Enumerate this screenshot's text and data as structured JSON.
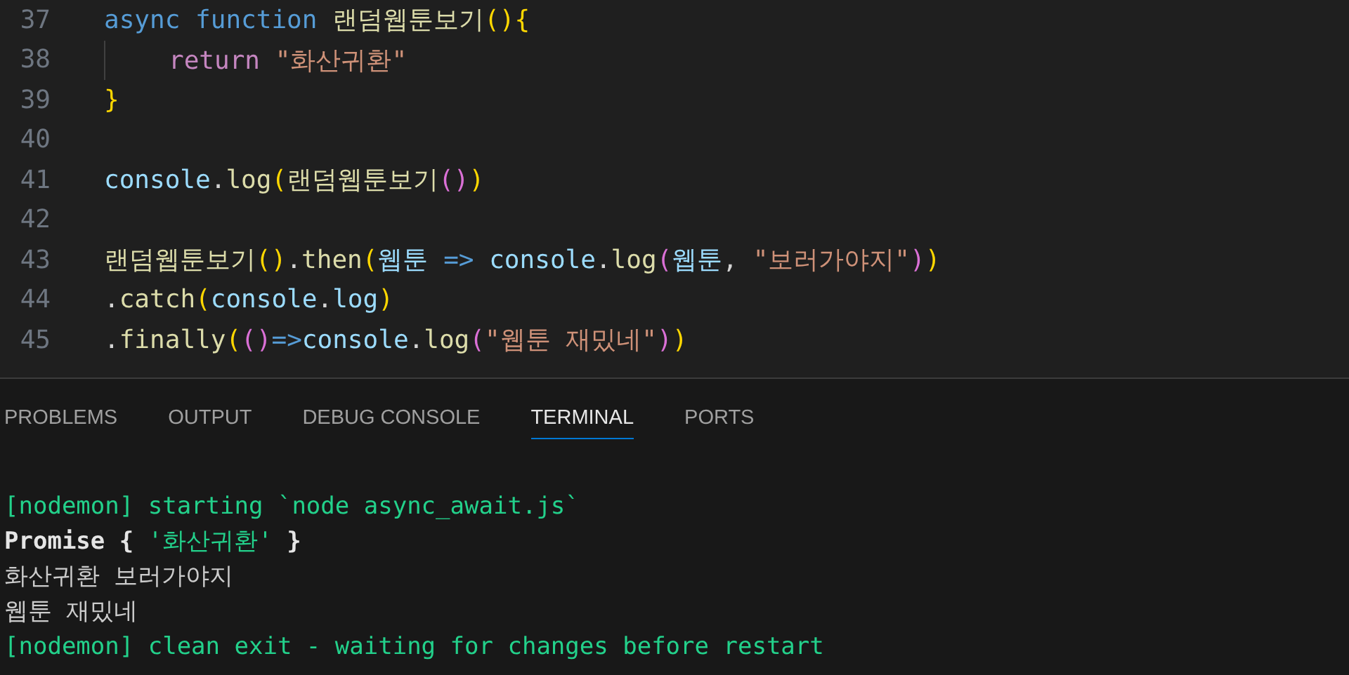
{
  "editor": {
    "lines": [
      {
        "number": "37",
        "tokens": [
          {
            "kind": "keyword",
            "text": "async function"
          },
          {
            "kind": "function",
            "text": " 랜덤웹툰보기"
          },
          {
            "kind": "bracket1",
            "text": "(){"
          }
        ]
      },
      {
        "number": "38",
        "indent_guide": true,
        "tokens": [
          {
            "kind": "control",
            "text": "return "
          },
          {
            "kind": "string",
            "text": "\"화산귀환\""
          }
        ]
      },
      {
        "number": "39",
        "tokens": [
          {
            "kind": "bracket1",
            "text": "}"
          }
        ]
      },
      {
        "number": "40"
      },
      {
        "number": "41",
        "tokens": [
          {
            "kind": "variable",
            "text": "console"
          },
          {
            "kind": "plain",
            "text": "."
          },
          {
            "kind": "function",
            "text": "log"
          },
          {
            "kind": "bracket1",
            "text": "("
          },
          {
            "kind": "function",
            "text": "랜덤웹툰보기"
          },
          {
            "kind": "bracket2",
            "text": "()"
          },
          {
            "kind": "bracket1",
            "text": ")"
          }
        ]
      },
      {
        "number": "42"
      },
      {
        "number": "43",
        "tokens": [
          {
            "kind": "function",
            "text": "랜덤웹툰보기"
          },
          {
            "kind": "bracket1",
            "text": "()"
          },
          {
            "kind": "plain",
            "text": "."
          },
          {
            "kind": "function",
            "text": "then"
          },
          {
            "kind": "bracket1",
            "text": "("
          },
          {
            "kind": "variable",
            "text": "웹툰 "
          },
          {
            "kind": "keyword",
            "text": "=> "
          },
          {
            "kind": "variable",
            "text": "console"
          },
          {
            "kind": "plain",
            "text": "."
          },
          {
            "kind": "function",
            "text": "log"
          },
          {
            "kind": "bracket2",
            "text": "("
          },
          {
            "kind": "variable",
            "text": "웹툰"
          },
          {
            "kind": "plain",
            "text": ", "
          },
          {
            "kind": "string",
            "text": "\"보러가야지\""
          },
          {
            "kind": "bracket2",
            "text": ")"
          },
          {
            "kind": "bracket1",
            "text": ")"
          }
        ]
      },
      {
        "number": "44",
        "tokens": [
          {
            "kind": "plain",
            "text": "."
          },
          {
            "kind": "function",
            "text": "catch"
          },
          {
            "kind": "bracket1",
            "text": "("
          },
          {
            "kind": "variable",
            "text": "console"
          },
          {
            "kind": "plain",
            "text": "."
          },
          {
            "kind": "variable",
            "text": "log"
          },
          {
            "kind": "bracket1",
            "text": ")"
          }
        ]
      },
      {
        "number": "45",
        "tokens": [
          {
            "kind": "plain",
            "text": "."
          },
          {
            "kind": "function",
            "text": "finally"
          },
          {
            "kind": "bracket1",
            "text": "("
          },
          {
            "kind": "bracket2",
            "text": "()"
          },
          {
            "kind": "keyword",
            "text": "=>"
          },
          {
            "kind": "variable",
            "text": "console"
          },
          {
            "kind": "plain",
            "text": "."
          },
          {
            "kind": "function",
            "text": "log"
          },
          {
            "kind": "bracket2",
            "text": "("
          },
          {
            "kind": "string",
            "text": "\"웹툰 재밌네\""
          },
          {
            "kind": "bracket2",
            "text": ")"
          },
          {
            "kind": "bracket1",
            "text": ")"
          }
        ]
      }
    ]
  },
  "panel": {
    "tabs": [
      {
        "label": "PROBLEMS",
        "selected": false
      },
      {
        "label": "OUTPUT",
        "selected": false
      },
      {
        "label": "DEBUG CONSOLE",
        "selected": false
      },
      {
        "label": "TERMINAL",
        "selected": true
      },
      {
        "label": "PORTS",
        "selected": false
      }
    ],
    "terminal_lines": [
      [
        {
          "kind": "green",
          "text": "[nodemon] starting `node async_await.js`"
        }
      ],
      [
        {
          "kind": "bold",
          "text": "Promise { "
        },
        {
          "kind": "green",
          "text": "'화산귀환'"
        },
        {
          "kind": "bold",
          "text": " }"
        }
      ],
      [
        {
          "kind": "plain",
          "text": "화산귀환 보러가야지"
        }
      ],
      [
        {
          "kind": "plain",
          "text": "웹툰 재밌네"
        }
      ],
      [
        {
          "kind": "green",
          "text": "[nodemon] clean exit - waiting for changes before restart"
        }
      ]
    ]
  }
}
